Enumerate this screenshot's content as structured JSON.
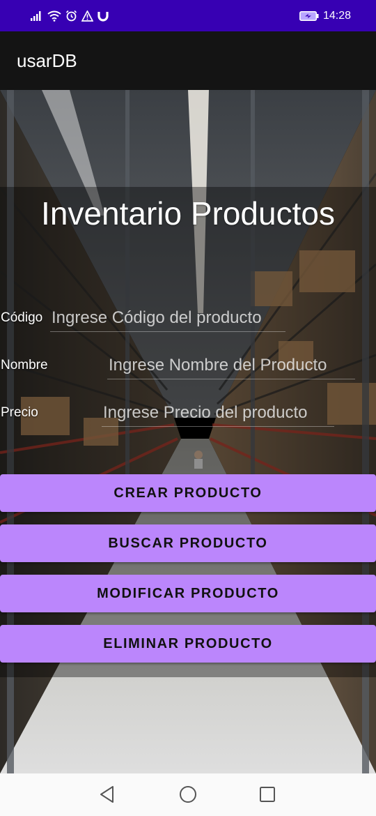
{
  "status_bar": {
    "time": "14:28",
    "left_icons": [
      "signal-icon",
      "wifi-icon",
      "alarm-icon",
      "warning-icon",
      "magnet-icon"
    ],
    "battery_icon": "battery-charging-icon"
  },
  "app_bar": {
    "title": "usarDB"
  },
  "main": {
    "title": "Inventario Productos",
    "fields": {
      "codigo": {
        "label": "Código",
        "placeholder": "Ingrese Código del producto",
        "value": ""
      },
      "nombre": {
        "label": "Nombre",
        "placeholder": "Ingrese Nombre del Producto",
        "value": ""
      },
      "precio": {
        "label": "Precio",
        "placeholder": "Ingrese Precio del producto",
        "value": ""
      }
    },
    "buttons": {
      "crear": "CREAR PRODUCTO",
      "buscar": "BUSCAR PRODUCTO",
      "modificar": "MODIFICAR PRODUCTO",
      "eliminar": "ELIMINAR PRODUCTO"
    }
  },
  "nav_bar": {
    "icons": [
      "back-icon",
      "home-icon",
      "recents-icon"
    ]
  },
  "colors": {
    "status_bar": "#3700b3",
    "app_bar": "#141414",
    "button": "#bb86fc",
    "nav_bar": "#fafafa"
  }
}
